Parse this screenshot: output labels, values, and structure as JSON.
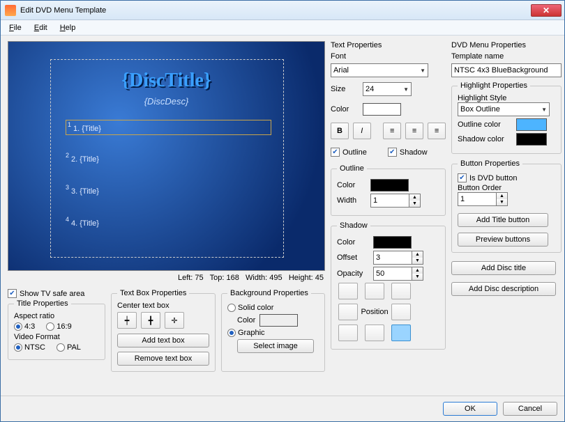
{
  "window": {
    "title": "Edit DVD Menu Template"
  },
  "menu": {
    "file": "File",
    "edit": "Edit",
    "help": "Help"
  },
  "preview": {
    "discTitle": "{DiscTitle}",
    "discDesc": "{DiscDesc}",
    "items": [
      "1. {Title}",
      "2. {Title}",
      "3. {Title}",
      "4. {Title}"
    ]
  },
  "status": {
    "left_lbl": "Left:",
    "left": "75",
    "top_lbl": "Top:",
    "top": "168",
    "width_lbl": "Width:",
    "width": "495",
    "height_lbl": "Height:",
    "height": "45"
  },
  "safe": {
    "label": "Show TV safe area",
    "checked": true
  },
  "titleProps": {
    "legend": "Title Properties",
    "aspect_lbl": "Aspect ratio",
    "aspect_43": "4:3",
    "aspect_169": "16:9",
    "videofmt_lbl": "Video Format",
    "ntsc": "NTSC",
    "pal": "PAL"
  },
  "textBox": {
    "legend": "Text Box Properties",
    "center_lbl": "Center text box",
    "add": "Add text box",
    "remove": "Remove text box"
  },
  "bgProps": {
    "legend": "Background Properties",
    "solid": "Solid color",
    "color_lbl": "Color",
    "graphic": "Graphic",
    "select": "Select image"
  },
  "textProps": {
    "heading": "Text Properties",
    "font_lbl": "Font",
    "font": "Arial",
    "size_lbl": "Size",
    "size": "24",
    "color_lbl": "Color",
    "outline_chk": "Outline",
    "shadow_chk": "Shadow",
    "outline": {
      "legend": "Outline",
      "color_lbl": "Color",
      "width_lbl": "Width",
      "width": "1"
    },
    "shadow": {
      "legend": "Shadow",
      "color_lbl": "Color",
      "offset_lbl": "Offset",
      "offset": "3",
      "opacity_lbl": "Opacity",
      "opacity": "50",
      "position_lbl": "Position"
    }
  },
  "dvdProps": {
    "heading": "DVD Menu Properties",
    "template_lbl": "Template name",
    "template": "NTSC 4x3 BlueBackground"
  },
  "highlight": {
    "legend": "Highlight Properties",
    "style_lbl": "Highlight Style",
    "style": "Box Outline",
    "outline_lbl": "Outline color",
    "shadow_lbl": "Shadow color"
  },
  "buttonProps": {
    "legend": "Button Properties",
    "isdvd": "Is DVD button",
    "order_lbl": "Button Order",
    "order": "1",
    "addTitle": "Add Title button",
    "preview": "Preview buttons"
  },
  "disc": {
    "addTitle": "Add Disc title",
    "addDesc": "Add Disc description"
  },
  "footer": {
    "ok": "OK",
    "cancel": "Cancel"
  }
}
